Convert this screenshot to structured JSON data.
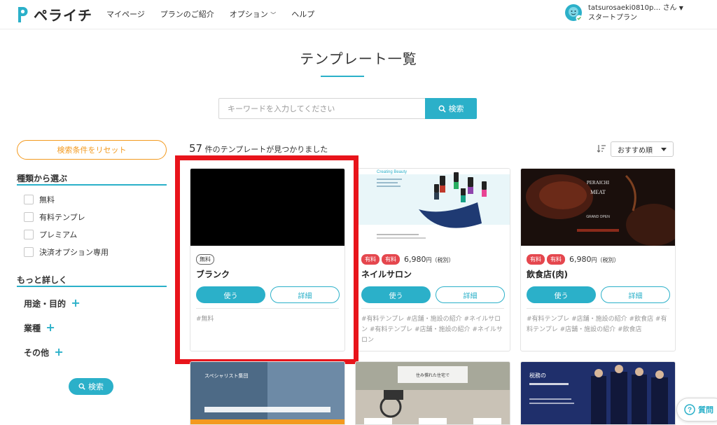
{
  "header": {
    "logo_text": "ペライチ",
    "nav": [
      "マイページ",
      "プランのご紹介",
      "オプション",
      "ヘルプ"
    ],
    "user_name": "tatsurosaeki0810p… さん",
    "user_plan": "スタートプラン"
  },
  "page_title": "テンプレート一覧",
  "search": {
    "placeholder": "キーワードを入力してください",
    "button_label": "検索"
  },
  "sidebar": {
    "reset_label": "検索条件をリセット",
    "type_heading": "種類から選ぶ",
    "type_options": [
      "無料",
      "有料テンプレ",
      "プレミアム",
      "決済オプション専用"
    ],
    "detail_heading": "もっと詳しく",
    "expanders": [
      "用途・目的",
      "業種",
      "その他"
    ],
    "search_label": "検索"
  },
  "results": {
    "count": "57",
    "count_suffix": "件のテンプレートが見つかりました",
    "sort_label": "おすすめ順"
  },
  "cards": [
    {
      "badges": [
        "無料"
      ],
      "name": "ブランク",
      "use_label": "使う",
      "detail_label": "詳細",
      "tags": "#無料"
    },
    {
      "badges": [
        "有料",
        "有料"
      ],
      "price": "6,980",
      "price_unit": "円",
      "price_note": "（税別）",
      "name": "ネイルサロン",
      "use_label": "使う",
      "detail_label": "詳細",
      "tags": "#有料テンプレ #店舗・施設の紹介 #ネイルサロン #有料テンプレ #店舗・施設の紹介 #ネイルサロン",
      "thumb_title": "Creating Beauty"
    },
    {
      "badges": [
        "有料",
        "有料"
      ],
      "price": "6,980",
      "price_unit": "円",
      "price_note": "（税別）",
      "name": "飲食店(肉)",
      "use_label": "使う",
      "detail_label": "詳細",
      "tags": "#有料テンプレ #店舗・施設の紹介 #飲食店 #有料テンプレ #店舗・施設の紹介 #飲食店",
      "thumb_title": "PERAICHI",
      "thumb_subtitle": "MEAT",
      "thumb_note": "GRAND OPEN"
    }
  ],
  "bottom_cards": [
    {
      "thumb_text": "スペシャリスト集団"
    },
    {
      "thumb_text": "住み慣れた住宅で"
    },
    {
      "thumb_text": "税務の"
    }
  ],
  "help_label": "質問",
  "colors": {
    "accent": "#2bb0c9",
    "orange": "#f39a1f",
    "red": "#e5474e",
    "highlight": "#e8141b"
  }
}
